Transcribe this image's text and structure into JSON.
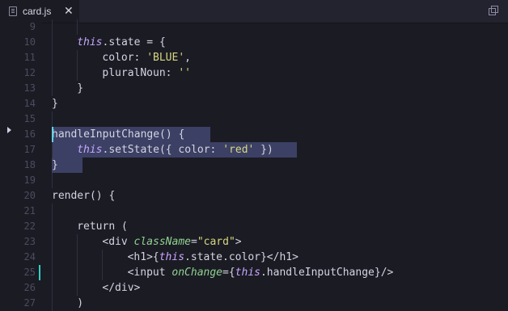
{
  "tab": {
    "title": "card.js",
    "close": "✕"
  },
  "editor": {
    "line_numbers": [
      "9",
      "10",
      "11",
      "12",
      "13",
      "14",
      "15",
      "16",
      "17",
      "18",
      "19",
      "20",
      "21",
      "22",
      "23",
      "24",
      "25",
      "26",
      "27"
    ],
    "lines": [
      [],
      [
        {
          "t": "this",
          "c": "this"
        },
        {
          "t": ".state = {",
          "c": "plain"
        }
      ],
      [
        {
          "t": "color: ",
          "c": "plain"
        },
        {
          "t": "'BLUE'",
          "c": "str"
        },
        {
          "t": ",",
          "c": "plain"
        }
      ],
      [
        {
          "t": "pluralNoun: ",
          "c": "plain"
        },
        {
          "t": "''",
          "c": "str"
        }
      ],
      [
        {
          "t": "}",
          "c": "plain"
        }
      ],
      [
        {
          "t": "}",
          "c": "plain"
        }
      ],
      [],
      [
        {
          "t": "handleInputChange() {",
          "c": "plain"
        }
      ],
      [
        {
          "t": "this",
          "c": "this"
        },
        {
          "t": ".setState({ color: ",
          "c": "plain"
        },
        {
          "t": "'red'",
          "c": "str"
        },
        {
          "t": " })",
          "c": "plain"
        }
      ],
      [
        {
          "t": "}",
          "c": "plain"
        }
      ],
      [],
      [
        {
          "t": "render() {",
          "c": "plain"
        }
      ],
      [],
      [
        {
          "t": "return (",
          "c": "plain"
        }
      ],
      [
        {
          "t": "<div ",
          "c": "plain"
        },
        {
          "t": "className",
          "c": "attr"
        },
        {
          "t": "=",
          "c": "plain"
        },
        {
          "t": "\"card\"",
          "c": "str"
        },
        {
          "t": ">",
          "c": "plain"
        }
      ],
      [
        {
          "t": "<h1>{",
          "c": "plain"
        },
        {
          "t": "this",
          "c": "this"
        },
        {
          "t": ".state.color}</h1>",
          "c": "plain"
        }
      ],
      [
        {
          "t": "<input ",
          "c": "plain"
        },
        {
          "t": "onChange",
          "c": "attr"
        },
        {
          "t": "={",
          "c": "plain"
        },
        {
          "t": "this",
          "c": "this"
        },
        {
          "t": ".handleInputChange}/>",
          "c": "plain"
        }
      ],
      [
        {
          "t": "</div>",
          "c": "plain"
        }
      ],
      [
        {
          "t": ")",
          "c": "plain"
        }
      ]
    ]
  }
}
